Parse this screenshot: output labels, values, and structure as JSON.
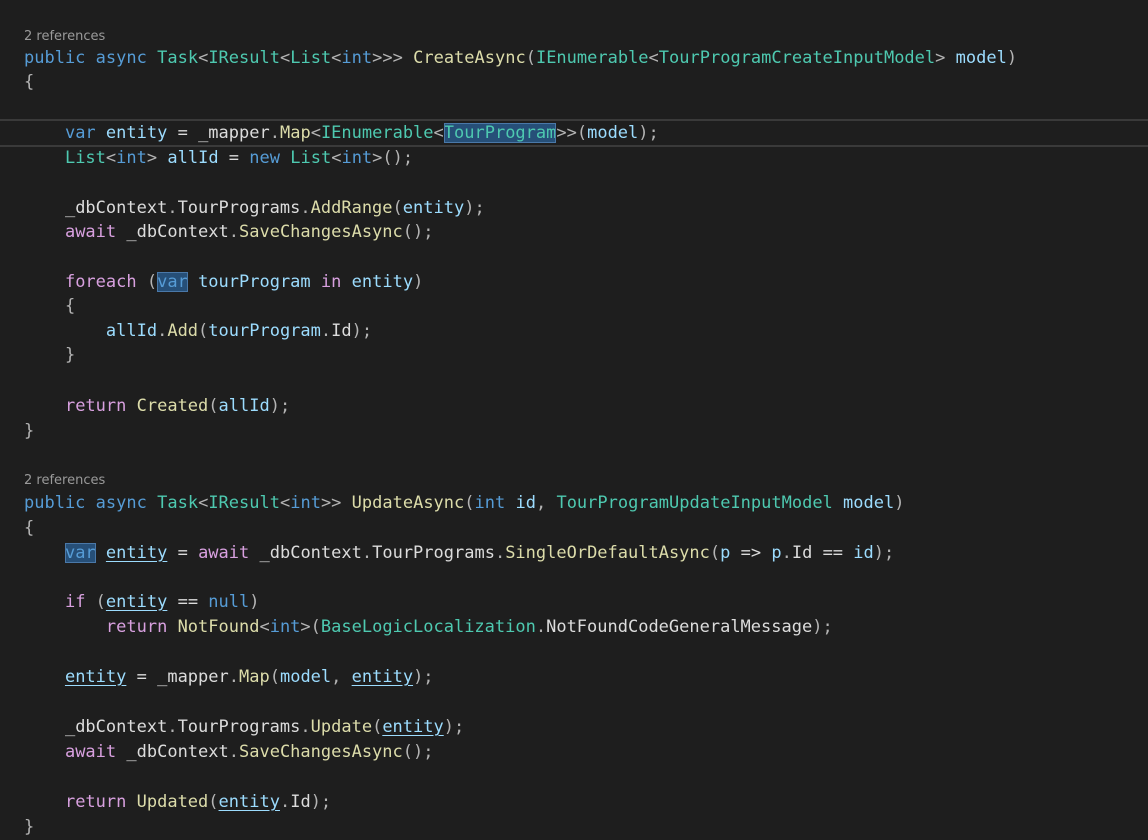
{
  "editor": {
    "colors": {
      "background": "#1e1e1e",
      "keyword": "#569cd6",
      "control": "#d8a0df",
      "type": "#4ec9b0",
      "method": "#dcdcaa",
      "local": "#9cdcfe",
      "text": "#dcdcdc"
    },
    "lines": [
      {
        "codelens": "2 references"
      },
      {
        "tokens": [
          {
            "t": "public",
            "c": "kw"
          },
          {
            "t": " ",
            "c": "plain"
          },
          {
            "t": "async",
            "c": "kw"
          },
          {
            "t": " ",
            "c": "plain"
          },
          {
            "t": "Task",
            "c": "type"
          },
          {
            "t": "<",
            "c": "punct"
          },
          {
            "t": "IResult",
            "c": "type"
          },
          {
            "t": "<",
            "c": "punct"
          },
          {
            "t": "List",
            "c": "type"
          },
          {
            "t": "<",
            "c": "punct"
          },
          {
            "t": "int",
            "c": "kw"
          },
          {
            "t": ">>>",
            "c": "punct"
          },
          {
            "t": " ",
            "c": "plain"
          },
          {
            "t": "CreateAsync",
            "c": "method"
          },
          {
            "t": "(",
            "c": "punct"
          },
          {
            "t": "IEnumerable",
            "c": "type"
          },
          {
            "t": "<",
            "c": "punct"
          },
          {
            "t": "TourProgramCreateInputModel",
            "c": "type"
          },
          {
            "t": ">",
            "c": "punct"
          },
          {
            "t": " ",
            "c": "plain"
          },
          {
            "t": "model",
            "c": "local"
          },
          {
            "t": ")",
            "c": "punct"
          }
        ]
      },
      {
        "tokens": [
          {
            "t": "{",
            "c": "punct"
          }
        ]
      },
      {
        "tokens": []
      },
      {
        "current": true,
        "tokens": [
          {
            "t": "    ",
            "c": "plain"
          },
          {
            "t": "var",
            "c": "kw"
          },
          {
            "t": " ",
            "c": "plain"
          },
          {
            "t": "entity",
            "c": "local"
          },
          {
            "t": " = ",
            "c": "plain"
          },
          {
            "t": "_mapper",
            "c": "plain"
          },
          {
            "t": ".",
            "c": "punct"
          },
          {
            "t": "Map",
            "c": "method"
          },
          {
            "t": "<",
            "c": "punct"
          },
          {
            "t": "IEnumerable",
            "c": "type"
          },
          {
            "t": "<",
            "c": "punct"
          },
          {
            "t": "TourProgram",
            "c": "type",
            "box": true
          },
          {
            "t": ">>(",
            "c": "punct"
          },
          {
            "t": "model",
            "c": "local"
          },
          {
            "t": ");",
            "c": "punct"
          }
        ]
      },
      {
        "tokens": [
          {
            "t": "    ",
            "c": "plain"
          },
          {
            "t": "List",
            "c": "type"
          },
          {
            "t": "<",
            "c": "punct"
          },
          {
            "t": "int",
            "c": "kw"
          },
          {
            "t": ">",
            "c": "punct"
          },
          {
            "t": " ",
            "c": "plain"
          },
          {
            "t": "allId",
            "c": "local"
          },
          {
            "t": " = ",
            "c": "plain"
          },
          {
            "t": "new",
            "c": "kw"
          },
          {
            "t": " ",
            "c": "plain"
          },
          {
            "t": "List",
            "c": "type"
          },
          {
            "t": "<",
            "c": "punct"
          },
          {
            "t": "int",
            "c": "kw"
          },
          {
            "t": ">();",
            "c": "punct"
          }
        ]
      },
      {
        "tokens": []
      },
      {
        "tokens": [
          {
            "t": "    ",
            "c": "plain"
          },
          {
            "t": "_dbContext",
            "c": "plain"
          },
          {
            "t": ".",
            "c": "punct"
          },
          {
            "t": "TourPrograms",
            "c": "prop"
          },
          {
            "t": ".",
            "c": "punct"
          },
          {
            "t": "AddRange",
            "c": "method"
          },
          {
            "t": "(",
            "c": "punct"
          },
          {
            "t": "entity",
            "c": "local"
          },
          {
            "t": ");",
            "c": "punct"
          }
        ]
      },
      {
        "tokens": [
          {
            "t": "    ",
            "c": "plain"
          },
          {
            "t": "await",
            "c": "ctrl"
          },
          {
            "t": " ",
            "c": "plain"
          },
          {
            "t": "_dbContext",
            "c": "plain"
          },
          {
            "t": ".",
            "c": "punct"
          },
          {
            "t": "SaveChangesAsync",
            "c": "method"
          },
          {
            "t": "();",
            "c": "punct"
          }
        ]
      },
      {
        "tokens": []
      },
      {
        "tokens": [
          {
            "t": "    ",
            "c": "plain"
          },
          {
            "t": "foreach",
            "c": "ctrl"
          },
          {
            "t": " (",
            "c": "punct"
          },
          {
            "t": "var",
            "c": "kw",
            "box": true
          },
          {
            "t": " ",
            "c": "plain"
          },
          {
            "t": "tourProgram",
            "c": "local"
          },
          {
            "t": " ",
            "c": "plain"
          },
          {
            "t": "in",
            "c": "ctrl"
          },
          {
            "t": " ",
            "c": "plain"
          },
          {
            "t": "entity",
            "c": "local"
          },
          {
            "t": ")",
            "c": "punct"
          }
        ]
      },
      {
        "tokens": [
          {
            "t": "    ",
            "c": "plain"
          },
          {
            "t": "{",
            "c": "punct"
          }
        ]
      },
      {
        "tokens": [
          {
            "t": "        ",
            "c": "plain"
          },
          {
            "t": "allId",
            "c": "local"
          },
          {
            "t": ".",
            "c": "punct"
          },
          {
            "t": "Add",
            "c": "method"
          },
          {
            "t": "(",
            "c": "punct"
          },
          {
            "t": "tourProgram",
            "c": "local"
          },
          {
            "t": ".",
            "c": "punct"
          },
          {
            "t": "Id",
            "c": "prop"
          },
          {
            "t": ");",
            "c": "punct"
          }
        ]
      },
      {
        "tokens": [
          {
            "t": "    ",
            "c": "plain"
          },
          {
            "t": "}",
            "c": "punct"
          }
        ]
      },
      {
        "tokens": []
      },
      {
        "tokens": [
          {
            "t": "    ",
            "c": "plain"
          },
          {
            "t": "return",
            "c": "ctrl"
          },
          {
            "t": " ",
            "c": "plain"
          },
          {
            "t": "Created",
            "c": "method"
          },
          {
            "t": "(",
            "c": "punct"
          },
          {
            "t": "allId",
            "c": "local"
          },
          {
            "t": ");",
            "c": "punct"
          }
        ]
      },
      {
        "tokens": [
          {
            "t": "}",
            "c": "punct"
          }
        ]
      },
      {
        "tokens": []
      },
      {
        "codelens": "2 references"
      },
      {
        "tokens": [
          {
            "t": "public",
            "c": "kw"
          },
          {
            "t": " ",
            "c": "plain"
          },
          {
            "t": "async",
            "c": "kw"
          },
          {
            "t": " ",
            "c": "plain"
          },
          {
            "t": "Task",
            "c": "type"
          },
          {
            "t": "<",
            "c": "punct"
          },
          {
            "t": "IResult",
            "c": "type"
          },
          {
            "t": "<",
            "c": "punct"
          },
          {
            "t": "int",
            "c": "kw"
          },
          {
            "t": ">>",
            "c": "punct"
          },
          {
            "t": " ",
            "c": "plain"
          },
          {
            "t": "UpdateAsync",
            "c": "method"
          },
          {
            "t": "(",
            "c": "punct"
          },
          {
            "t": "int",
            "c": "kw"
          },
          {
            "t": " ",
            "c": "plain"
          },
          {
            "t": "id",
            "c": "local"
          },
          {
            "t": ", ",
            "c": "punct"
          },
          {
            "t": "TourProgramUpdateInputModel",
            "c": "type"
          },
          {
            "t": " ",
            "c": "plain"
          },
          {
            "t": "model",
            "c": "local"
          },
          {
            "t": ")",
            "c": "punct"
          }
        ]
      },
      {
        "tokens": [
          {
            "t": "{",
            "c": "punct"
          }
        ]
      },
      {
        "tokens": [
          {
            "t": "    ",
            "c": "plain"
          },
          {
            "t": "var",
            "c": "kw",
            "box": true
          },
          {
            "t": " ",
            "c": "plain"
          },
          {
            "t": "entity",
            "c": "local",
            "ul": true
          },
          {
            "t": " = ",
            "c": "plain"
          },
          {
            "t": "await",
            "c": "ctrl"
          },
          {
            "t": " ",
            "c": "plain"
          },
          {
            "t": "_dbContext",
            "c": "plain"
          },
          {
            "t": ".",
            "c": "punct"
          },
          {
            "t": "TourPrograms",
            "c": "prop"
          },
          {
            "t": ".",
            "c": "punct"
          },
          {
            "t": "SingleOrDefaultAsync",
            "c": "method"
          },
          {
            "t": "(",
            "c": "punct"
          },
          {
            "t": "p",
            "c": "local"
          },
          {
            "t": " => ",
            "c": "plain"
          },
          {
            "t": "p",
            "c": "local"
          },
          {
            "t": ".",
            "c": "punct"
          },
          {
            "t": "Id",
            "c": "prop"
          },
          {
            "t": " == ",
            "c": "plain"
          },
          {
            "t": "id",
            "c": "local"
          },
          {
            "t": ");",
            "c": "punct"
          }
        ]
      },
      {
        "tokens": []
      },
      {
        "tokens": [
          {
            "t": "    ",
            "c": "plain"
          },
          {
            "t": "if",
            "c": "ctrl"
          },
          {
            "t": " (",
            "c": "punct"
          },
          {
            "t": "entity",
            "c": "local",
            "ul": true
          },
          {
            "t": " == ",
            "c": "plain"
          },
          {
            "t": "null",
            "c": "kw"
          },
          {
            "t": ")",
            "c": "punct"
          }
        ]
      },
      {
        "tokens": [
          {
            "t": "        ",
            "c": "plain"
          },
          {
            "t": "return",
            "c": "ctrl"
          },
          {
            "t": " ",
            "c": "plain"
          },
          {
            "t": "NotFound",
            "c": "method"
          },
          {
            "t": "<",
            "c": "punct"
          },
          {
            "t": "int",
            "c": "kw"
          },
          {
            "t": ">(",
            "c": "punct"
          },
          {
            "t": "BaseLogicLocalization",
            "c": "type"
          },
          {
            "t": ".",
            "c": "punct"
          },
          {
            "t": "NotFoundCodeGeneralMessage",
            "c": "prop"
          },
          {
            "t": ");",
            "c": "punct"
          }
        ]
      },
      {
        "tokens": []
      },
      {
        "tokens": [
          {
            "t": "    ",
            "c": "plain"
          },
          {
            "t": "entity",
            "c": "local",
            "ul": true
          },
          {
            "t": " = ",
            "c": "plain"
          },
          {
            "t": "_mapper",
            "c": "plain"
          },
          {
            "t": ".",
            "c": "punct"
          },
          {
            "t": "Map",
            "c": "method"
          },
          {
            "t": "(",
            "c": "punct"
          },
          {
            "t": "model",
            "c": "local"
          },
          {
            "t": ", ",
            "c": "punct"
          },
          {
            "t": "entity",
            "c": "local",
            "ul": true
          },
          {
            "t": ");",
            "c": "punct"
          }
        ]
      },
      {
        "tokens": []
      },
      {
        "tokens": [
          {
            "t": "    ",
            "c": "plain"
          },
          {
            "t": "_dbContext",
            "c": "plain"
          },
          {
            "t": ".",
            "c": "punct"
          },
          {
            "t": "TourPrograms",
            "c": "prop"
          },
          {
            "t": ".",
            "c": "punct"
          },
          {
            "t": "Update",
            "c": "method"
          },
          {
            "t": "(",
            "c": "punct"
          },
          {
            "t": "entity",
            "c": "local",
            "ul": true
          },
          {
            "t": ");",
            "c": "punct"
          }
        ]
      },
      {
        "tokens": [
          {
            "t": "    ",
            "c": "plain"
          },
          {
            "t": "await",
            "c": "ctrl"
          },
          {
            "t": " ",
            "c": "plain"
          },
          {
            "t": "_dbContext",
            "c": "plain"
          },
          {
            "t": ".",
            "c": "punct"
          },
          {
            "t": "SaveChangesAsync",
            "c": "method"
          },
          {
            "t": "();",
            "c": "punct"
          }
        ]
      },
      {
        "tokens": []
      },
      {
        "tokens": [
          {
            "t": "    ",
            "c": "plain"
          },
          {
            "t": "return",
            "c": "ctrl"
          },
          {
            "t": " ",
            "c": "plain"
          },
          {
            "t": "Updated",
            "c": "method"
          },
          {
            "t": "(",
            "c": "punct"
          },
          {
            "t": "entity",
            "c": "local",
            "ul": true
          },
          {
            "t": ".",
            "c": "punct"
          },
          {
            "t": "Id",
            "c": "prop"
          },
          {
            "t": ");",
            "c": "punct"
          }
        ]
      },
      {
        "tokens": [
          {
            "t": "}",
            "c": "punct"
          }
        ]
      }
    ]
  }
}
